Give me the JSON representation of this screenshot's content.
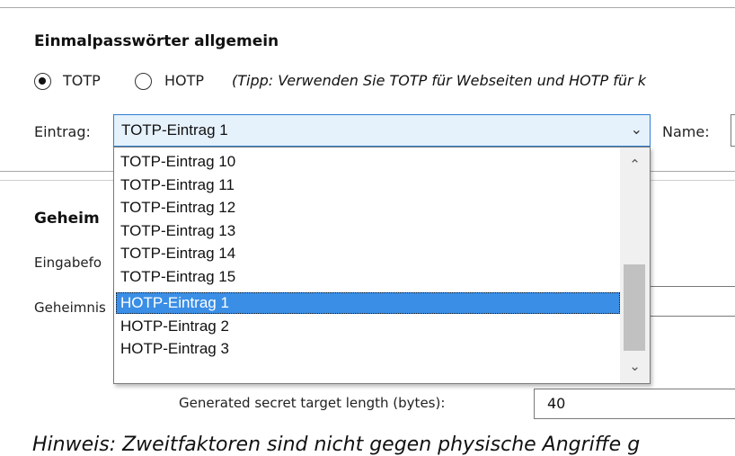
{
  "general": {
    "title": "Einmalpasswörter allgemein",
    "radio_totp": "TOTP",
    "radio_hotp": "HOTP",
    "selected_mode": "TOTP",
    "tip": "(Tipp: Verwenden Sie TOTP für Webseiten und HOTP für k"
  },
  "entry": {
    "label": "Eintrag:",
    "selected": "TOTP-Eintrag 1",
    "name_label": "Name:",
    "options_visible": [
      "TOTP-Eintrag 10",
      "TOTP-Eintrag 11",
      "TOTP-Eintrag 12",
      "TOTP-Eintrag 13",
      "TOTP-Eintrag 14",
      "TOTP-Eintrag 15",
      "HOTP-Eintrag 1",
      "HOTP-Eintrag 2",
      "HOTP-Eintrag 3"
    ],
    "highlighted_option": "HOTP-Eintrag 1"
  },
  "secret": {
    "title_partial": "Geheim",
    "input_format_label_partial": "Eingabefo",
    "secret_label_partial": "Geheimnis",
    "target_length_label": "Generated secret target length (bytes):",
    "target_length_value": "40"
  },
  "hint": {
    "text": "Hinweis: Zweitfaktoren sind nicht gegen physische Angriffe g"
  },
  "icons": {
    "dropdown": "chevron-down-icon",
    "scroll_up": "chevron-up-icon",
    "scroll_down": "chevron-down-icon"
  },
  "colors": {
    "combo_border": "#2e7fd1",
    "combo_bg": "#e5f1fb",
    "selection": "#3a8ee6"
  }
}
